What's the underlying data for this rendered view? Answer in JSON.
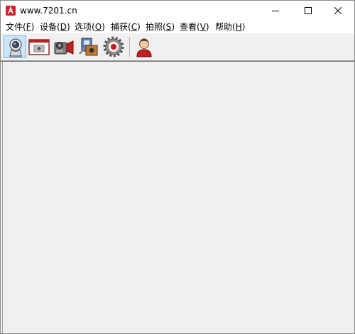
{
  "window": {
    "title": "www.7201.cn"
  },
  "menu": [
    {
      "name": "file",
      "label": "文件(",
      "key": "F",
      "end": ")"
    },
    {
      "name": "device",
      "label": "设备(",
      "key": "D",
      "end": ")"
    },
    {
      "name": "options",
      "label": "选项(",
      "key": "O",
      "end": ")"
    },
    {
      "name": "capture",
      "label": "捕获(",
      "key": "C",
      "end": ")"
    },
    {
      "name": "photo",
      "label": "拍照(",
      "key": "S",
      "end": ")"
    },
    {
      "name": "view",
      "label": "查看(",
      "key": "V",
      "end": ")"
    },
    {
      "name": "help",
      "label": "帮助(",
      "key": "H",
      "end": ")"
    }
  ],
  "toolbar": {
    "buttons": [
      "webcam-icon",
      "window-capture-icon",
      "camcorder-icon",
      "media-tools-icon",
      "record-gear-icon",
      "user-avatar-icon"
    ]
  },
  "colors": {
    "accent": "#d81e28",
    "client_bg": "#f0f0f0",
    "active_button": "#cce4f7"
  }
}
